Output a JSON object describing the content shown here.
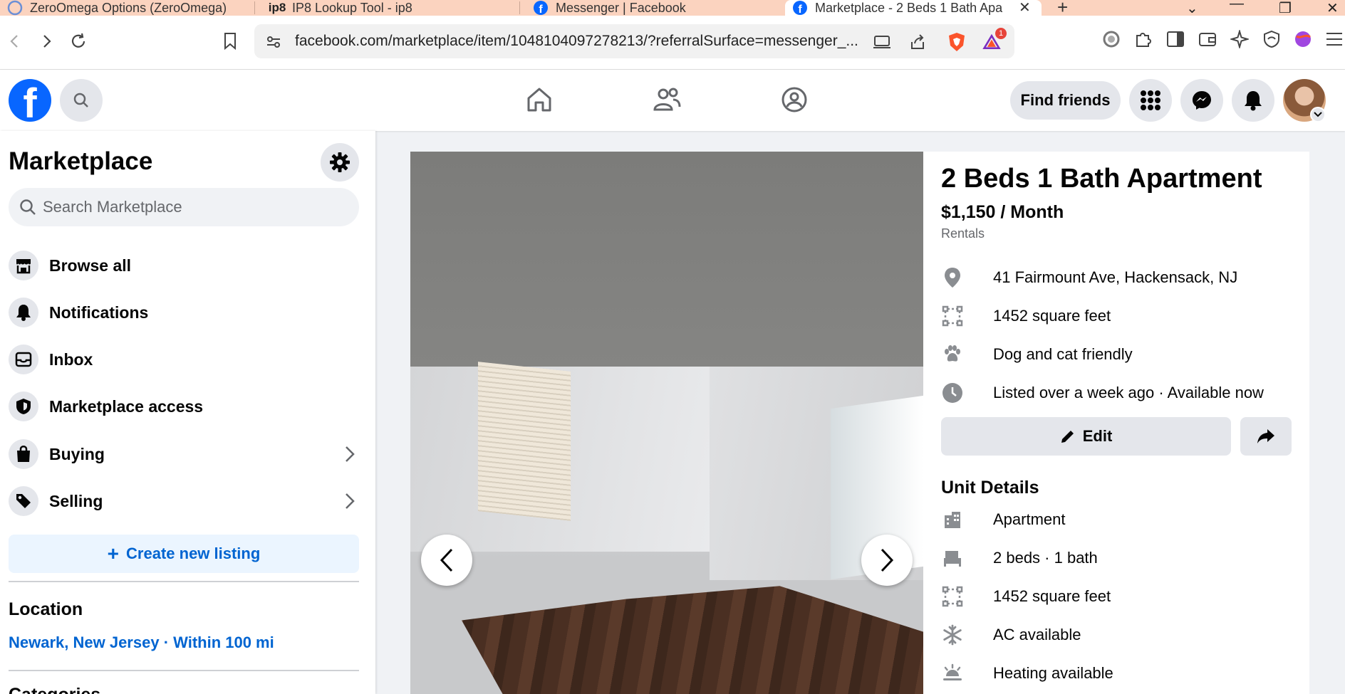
{
  "browser": {
    "tabs": [
      {
        "title": "ZeroOmega Options (ZeroOmega)",
        "icon": "zeroomega-icon"
      },
      {
        "title": "IP8 Lookup Tool - ip8",
        "icon": "ip8-icon"
      },
      {
        "title": "Messenger | Facebook",
        "icon": "facebook-icon"
      },
      {
        "title": "Marketplace - 2 Beds 1 Bath Apa",
        "icon": "facebook-icon",
        "active": true
      }
    ],
    "url": "facebook.com/marketplace/item/1048104097278213/?referralSurface=messenger_...",
    "notification_badge": "1"
  },
  "header": {
    "logo": "f",
    "find_friends": "Find friends"
  },
  "sidebar": {
    "title": "Marketplace",
    "search_placeholder": "Search Marketplace",
    "items": [
      {
        "label": "Browse all",
        "icon": "storefront-icon"
      },
      {
        "label": "Notifications",
        "icon": "bell-icon"
      },
      {
        "label": "Inbox",
        "icon": "inbox-icon"
      },
      {
        "label": "Marketplace access",
        "icon": "shield-icon"
      },
      {
        "label": "Buying",
        "icon": "shopping-bag-icon"
      },
      {
        "label": "Selling",
        "icon": "price-tag-icon"
      }
    ],
    "create_listing": "Create new listing",
    "location_title": "Location",
    "location_value": "Newark, New Jersey · Within 100 mi",
    "categories_title": "Categories"
  },
  "listing": {
    "title": "2 Beds 1 Bath Apartment",
    "price": "$1,150 / Month",
    "category": "Rentals",
    "facts": [
      {
        "text": "41 Fairmount Ave, Hackensack, NJ",
        "icon": "location-pin-icon"
      },
      {
        "text": "1452 square feet",
        "icon": "square-footage-icon"
      },
      {
        "text": "Dog and cat friendly",
        "icon": "paw-icon"
      },
      {
        "text": "Listed over a week ago · Available now",
        "icon": "clock-icon"
      }
    ],
    "edit_label": "Edit",
    "unit_details_title": "Unit Details",
    "unit_details": [
      {
        "text": "Apartment",
        "icon": "building-icon"
      },
      {
        "text": "2 beds · 1 bath",
        "icon": "bed-icon"
      },
      {
        "text": "1452 square feet",
        "icon": "square-footage-icon"
      },
      {
        "text": "AC available",
        "icon": "snowflake-icon"
      },
      {
        "text": "Heating available",
        "icon": "heat-icon"
      }
    ]
  },
  "colors": {
    "facebook_blue": "#0866ff",
    "link_blue": "#0064d1",
    "tab_strip": "#fbd3bf"
  }
}
